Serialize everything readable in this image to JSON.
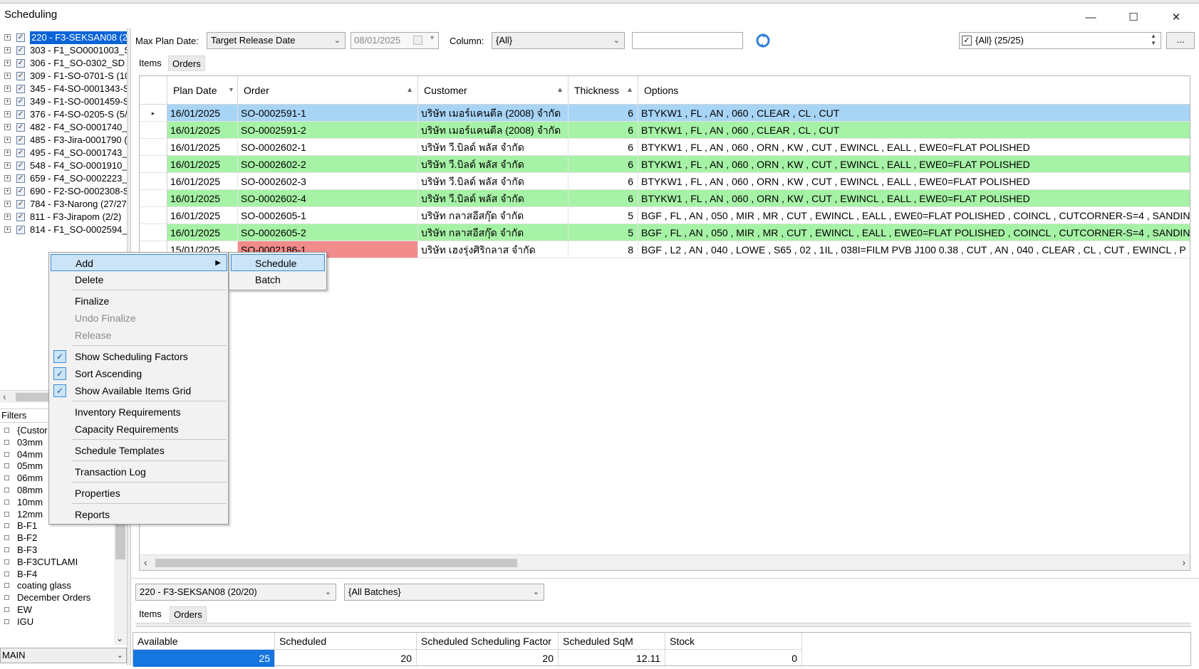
{
  "window": {
    "title": "Scheduling",
    "minimize": "—",
    "maximize": "☐",
    "close": "✕"
  },
  "tree": {
    "items": [
      {
        "label": "220 - F3-SEKSAN08 (2(",
        "selected": true
      },
      {
        "label": "303 - F1_SO0001003_S",
        "selected": false
      },
      {
        "label": "306 - F1_SO-0302_SD",
        "selected": false
      },
      {
        "label": "309 - F1-SO-0701-S (10",
        "selected": false
      },
      {
        "label": "345 - F4-SO-0001343-S",
        "selected": false
      },
      {
        "label": "349 - F1-SO-0001459-S",
        "selected": false
      },
      {
        "label": "376 - F4-SO-0205-S (5/!",
        "selected": false
      },
      {
        "label": "482 - F4_SO-0001740_",
        "selected": false
      },
      {
        "label": "485 - F3-Jira-0001790 (",
        "selected": false
      },
      {
        "label": "495 - F4_SO-0001743_",
        "selected": false
      },
      {
        "label": "548 - F4_SO-0001910_I",
        "selected": false
      },
      {
        "label": "659 - F4_SO-0002223_",
        "selected": false
      },
      {
        "label": "690 - F2-SO-0002308-S",
        "selected": false
      },
      {
        "label": "784 - F3-Narong (27/27",
        "selected": false
      },
      {
        "label": "811 - F3-Jirapom (2/2)",
        "selected": false
      },
      {
        "label": "814 - F1_SO-0002594_S",
        "selected": false
      }
    ]
  },
  "filters": {
    "header": "Filters",
    "items": [
      "{Custor",
      "03mm",
      "04mm",
      "05mm",
      "06mm",
      "08mm",
      "10mm",
      "12mm",
      "B-F1",
      "B-F2",
      "B-F3",
      "B-F3CUTLAMI",
      "B-F4",
      "coating glass",
      "December Orders",
      "EW",
      "IGU"
    ],
    "bottom_combo": "MAIN"
  },
  "toolbar": {
    "max_plan_date_label": "Max Plan Date:",
    "date_type": "Target Release Date",
    "date_value": "08/01/2025",
    "column_label": "Column:",
    "column_value": "{All}",
    "search_value": "",
    "all_filter": "{All} (25/25)",
    "more_button": "..."
  },
  "tabs_top": {
    "items": "Items",
    "orders": "Orders"
  },
  "grid": {
    "columns": {
      "plan_date": "Plan Date",
      "order": "Order",
      "customer": "Customer",
      "thickness": "Thickness",
      "options": "Options"
    },
    "rows": [
      {
        "plan_date": "16/01/2025",
        "order": "SO-0002591-1",
        "customer": "บริษัท เมอร์แคนตีล (2008) จำกัด",
        "thickness": "6",
        "options": "BTYKW1 , FL , AN , 060 , CLEAR , CL , CUT",
        "row_color": "#a8d4f6",
        "order_color": ""
      },
      {
        "plan_date": "16/01/2025",
        "order": "SO-0002591-2",
        "customer": "บริษัท เมอร์แคนตีล (2008) จำกัด",
        "thickness": "6",
        "options": "BTYKW1 , FL , AN , 060 , CLEAR , CL , CUT",
        "row_color": "#a6f2a6",
        "order_color": ""
      },
      {
        "plan_date": "16/01/2025",
        "order": "SO-0002602-1",
        "customer": "บริษัท วี.บิลด์ พลัส จำกัด",
        "thickness": "6",
        "options": "BTYKW1 , FL , AN , 060 , ORN , KW , CUT , EWINCL , EALL , EWE0=FLAT POLISHED",
        "row_color": "#ffffff",
        "order_color": ""
      },
      {
        "plan_date": "16/01/2025",
        "order": "SO-0002602-2",
        "customer": "บริษัท วี.บิลด์ พลัส จำกัด",
        "thickness": "6",
        "options": "BTYKW1 , FL , AN , 060 , ORN , KW , CUT , EWINCL , EALL , EWE0=FLAT POLISHED",
        "row_color": "#a6f2a6",
        "order_color": ""
      },
      {
        "plan_date": "16/01/2025",
        "order": "SO-0002602-3",
        "customer": "บริษัท วี.บิลด์ พลัส จำกัด",
        "thickness": "6",
        "options": "BTYKW1 , FL , AN , 060 , ORN , KW , CUT , EWINCL , EALL , EWE0=FLAT POLISHED",
        "row_color": "#ffffff",
        "order_color": ""
      },
      {
        "plan_date": "16/01/2025",
        "order": "SO-0002602-4",
        "customer": "บริษัท วี.บิลด์ พลัส จำกัด",
        "thickness": "6",
        "options": "BTYKW1 , FL , AN , 060 , ORN , KW , CUT , EWINCL , EALL , EWE0=FLAT POLISHED",
        "row_color": "#a6f2a6",
        "order_color": ""
      },
      {
        "plan_date": "16/01/2025",
        "order": "SO-0002605-1",
        "customer": "บริษัท กลาสอีสกุ๊ด จำกัด",
        "thickness": "5",
        "options": "BGF , FL , AN , 050 , MIR , MR , CUT , EWINCL , EALL , EWE0=FLAT POLISHED , COINCL , CUTCORNER-S=4 , SANDIN",
        "row_color": "#ffffff",
        "order_color": ""
      },
      {
        "plan_date": "16/01/2025",
        "order": "SO-0002605-2",
        "customer": "บริษัท กลาสอีสกุ๊ด จำกัด",
        "thickness": "5",
        "options": "BGF , FL , AN , 050 , MIR , MR , CUT , EWINCL , EALL , EWE0=FLAT POLISHED , COINCL , CUTCORNER-S=4 , SANDIN",
        "row_color": "#a6f2a6",
        "order_color": ""
      },
      {
        "plan_date": "15/01/2025",
        "order": "SO-0002186-1",
        "customer": "บริษัท เฮงรุ่งศิริกลาส จำกัด",
        "thickness": "8",
        "options": "BGF , L2 , AN , 040 , LOWE , S65 , 02 , 1IL , 038I=FILM PVB J100 0.38 , CUT , AN , 040 , CLEAR , CL , CUT , EWINCL , P",
        "row_color": "#ffffff",
        "order_color": "#f28b8b"
      }
    ],
    "current_row_marker": "▸"
  },
  "bottom": {
    "batch_combo": "220 - F3-SEKSAN08 (20/20)",
    "batches_combo": "{All Batches}",
    "tab_items": "Items",
    "tab_orders": "Orders",
    "summary_headers": {
      "available": "Available",
      "scheduled": "Scheduled",
      "scheduled_factor": "Scheduled Scheduling Factor",
      "scheduled_sqm": "Scheduled SqM",
      "stock": "Stock"
    },
    "summary_values": {
      "available": "25",
      "scheduled": "20",
      "scheduled_factor": "20",
      "scheduled_sqm": "12.11",
      "stock": "0"
    }
  },
  "context_menu": {
    "add": "Add",
    "delete": "Delete",
    "finalize": "Finalize",
    "undo_finalize": "Undo Finalize",
    "release": "Release",
    "show_scheduling_factors": "Show Scheduling Factors",
    "sort_ascending": "Sort Ascending",
    "show_available_items_grid": "Show Available Items Grid",
    "inventory_requirements": "Inventory Requirements",
    "capacity_requirements": "Capacity Requirements",
    "schedule_templates": "Schedule Templates",
    "transaction_log": "Transaction Log",
    "properties": "Properties",
    "reports": "Reports",
    "check_glyph": "✓"
  },
  "submenu": {
    "schedule": "Schedule",
    "batch": "Batch"
  },
  "colors": {
    "selection_blue": "#0a64d8",
    "row_highlight_blue": "#a8d4f6",
    "row_green": "#a6f2a6",
    "row_red": "#f28b8b",
    "menu_highlight": "#cce4f7",
    "available_fill": "#1676e0"
  },
  "icons": {
    "refresh": "refresh-icon",
    "tree_checkbox": "checkbox-icon",
    "expand": "plus-box-icon"
  }
}
